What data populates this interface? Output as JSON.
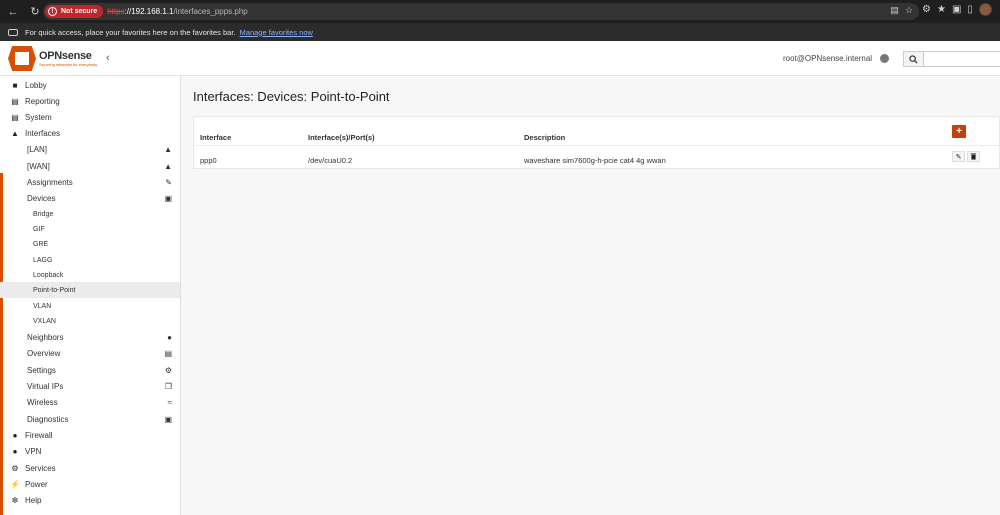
{
  "browser": {
    "not_secure_label": "Not secure",
    "url_scheme": "https",
    "url_host": "://192.168.1.1",
    "url_path": "/interfaces_ppps.php",
    "favorites_message": "For quick access, place your favorites here on the favorites bar.",
    "manage_favorites": "Manage favorites now"
  },
  "header": {
    "brand": "OPNsense",
    "tagline": "Securing networks for everybody",
    "user": "root@OPNsense.internal",
    "accent_color": "#d94f00"
  },
  "sidebar": {
    "items": [
      {
        "label": "Lobby",
        "icon": "laptop-icon"
      },
      {
        "label": "Reporting",
        "icon": "chart-icon"
      },
      {
        "label": "System",
        "icon": "server-icon"
      },
      {
        "label": "Interfaces",
        "icon": "sitemap-icon"
      },
      {
        "label": "[LAN]",
        "icon": "sitemap-icon"
      },
      {
        "label": "[WAN]",
        "icon": "sitemap-icon"
      },
      {
        "label": "Assignments",
        "icon": "pencil-icon"
      },
      {
        "label": "Devices",
        "icon": "archive-icon"
      },
      {
        "label": "Bridge"
      },
      {
        "label": "GIF"
      },
      {
        "label": "GRE"
      },
      {
        "label": "LAGG"
      },
      {
        "label": "Loopback"
      },
      {
        "label": "Point-to-Point"
      },
      {
        "label": "VLAN"
      },
      {
        "label": "VXLAN"
      },
      {
        "label": "Neighbors",
        "icon": "users-icon"
      },
      {
        "label": "Overview",
        "icon": "tasks-icon"
      },
      {
        "label": "Settings",
        "icon": "cogs-icon"
      },
      {
        "label": "Virtual IPs",
        "icon": "clone-icon"
      },
      {
        "label": "Wireless",
        "icon": "wifi-icon"
      },
      {
        "label": "Diagnostics",
        "icon": "medkit-icon"
      },
      {
        "label": "Firewall",
        "icon": "fire-icon"
      },
      {
        "label": "VPN",
        "icon": "globe-icon"
      },
      {
        "label": "Services",
        "icon": "cog-icon"
      },
      {
        "label": "Power",
        "icon": "plug-icon"
      },
      {
        "label": "Help",
        "icon": "support-icon"
      }
    ]
  },
  "main": {
    "title": "Interfaces: Devices: Point-to-Point",
    "table": {
      "columns": [
        "Interface",
        "Interface(s)/Port(s)",
        "Description"
      ],
      "rows": [
        {
          "interface": "ppp0",
          "ports": "/dev/cuaU0.2",
          "description": "waveshare sim7600g-h-pcie cat4 4g wwan"
        }
      ]
    }
  }
}
